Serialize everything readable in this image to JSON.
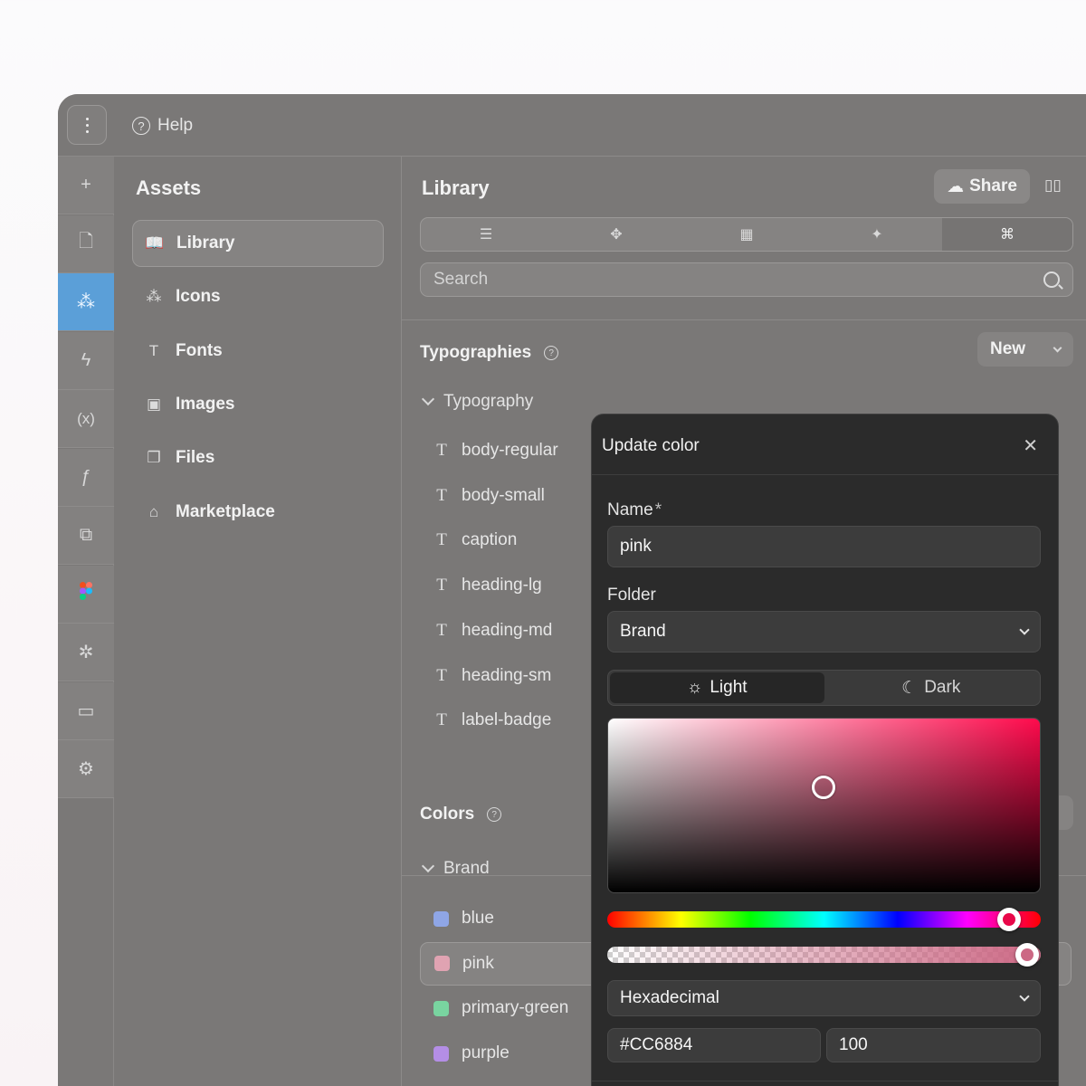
{
  "topbar": {
    "help_label": "Help"
  },
  "rail": {
    "items": [
      {
        "icon": "plus-icon",
        "glyph": "+"
      },
      {
        "icon": "page-icon",
        "glyph": "🗋"
      },
      {
        "icon": "assets-icon",
        "glyph": "⁂"
      },
      {
        "icon": "lightning-icon",
        "glyph": "ϟ"
      },
      {
        "icon": "variables-icon",
        "glyph": "(x)"
      },
      {
        "icon": "function-icon",
        "glyph": "ƒ"
      },
      {
        "icon": "plugin-icon",
        "glyph": "⧉"
      },
      {
        "icon": "figma-icon",
        "glyph": ""
      },
      {
        "icon": "bug-icon",
        "glyph": "✲"
      },
      {
        "icon": "terminal-icon",
        "glyph": "▭"
      },
      {
        "icon": "settings-icon",
        "glyph": "⚙"
      }
    ],
    "active_index": 2
  },
  "assets": {
    "title": "Assets",
    "items": [
      {
        "label": "Library",
        "icon": "book-icon",
        "glyph": "📖"
      },
      {
        "label": "Icons",
        "icon": "icons-icon",
        "glyph": "⁂"
      },
      {
        "label": "Fonts",
        "icon": "font-icon",
        "glyph": "T"
      },
      {
        "label": "Images",
        "icon": "image-icon",
        "glyph": "▣"
      },
      {
        "label": "Files",
        "icon": "files-icon",
        "glyph": "❐"
      },
      {
        "label": "Marketplace",
        "icon": "store-icon",
        "glyph": "⌂"
      }
    ],
    "active_index": 0
  },
  "library": {
    "title": "Library",
    "share_label": "Share",
    "search_placeholder": "Search",
    "tabs": [
      {
        "icon": "align-icon",
        "glyph": "☰"
      },
      {
        "icon": "component-icon",
        "glyph": "✥"
      },
      {
        "icon": "grid-icon",
        "glyph": "▦"
      },
      {
        "icon": "sparkle-icon",
        "glyph": "✦"
      },
      {
        "icon": "tokens-icon",
        "glyph": "⌘"
      }
    ],
    "active_tab": 4,
    "typographies": {
      "title": "Typographies",
      "new_label": "New",
      "folder": "Typography",
      "items": [
        "body-regular",
        "body-small",
        "caption",
        "heading-lg",
        "heading-md",
        "heading-sm",
        "label-badge"
      ]
    },
    "colors": {
      "title": "Colors",
      "folder": "Brand",
      "items": [
        {
          "name": "blue",
          "color": "#8fa6e6"
        },
        {
          "name": "pink",
          "color": "#e0a3b2"
        },
        {
          "name": "primary-green",
          "color": "#79d4a0"
        },
        {
          "name": "purple",
          "color": "#b48ee6"
        }
      ],
      "active_index": 1
    }
  },
  "modal": {
    "title": "Update color",
    "name_label": "Name",
    "required_mark": "*",
    "name_value": "pink",
    "folder_label": "Folder",
    "folder_value": "Brand",
    "mode_light": "Light",
    "mode_dark": "Dark",
    "format_value": "Hexadecimal",
    "hex_value": "#CC6884",
    "opacity_value": "100",
    "colors": {
      "selected": "#CC6884",
      "hue_pure": "#ff0a4c",
      "hue_knob": "#e9084a"
    }
  }
}
